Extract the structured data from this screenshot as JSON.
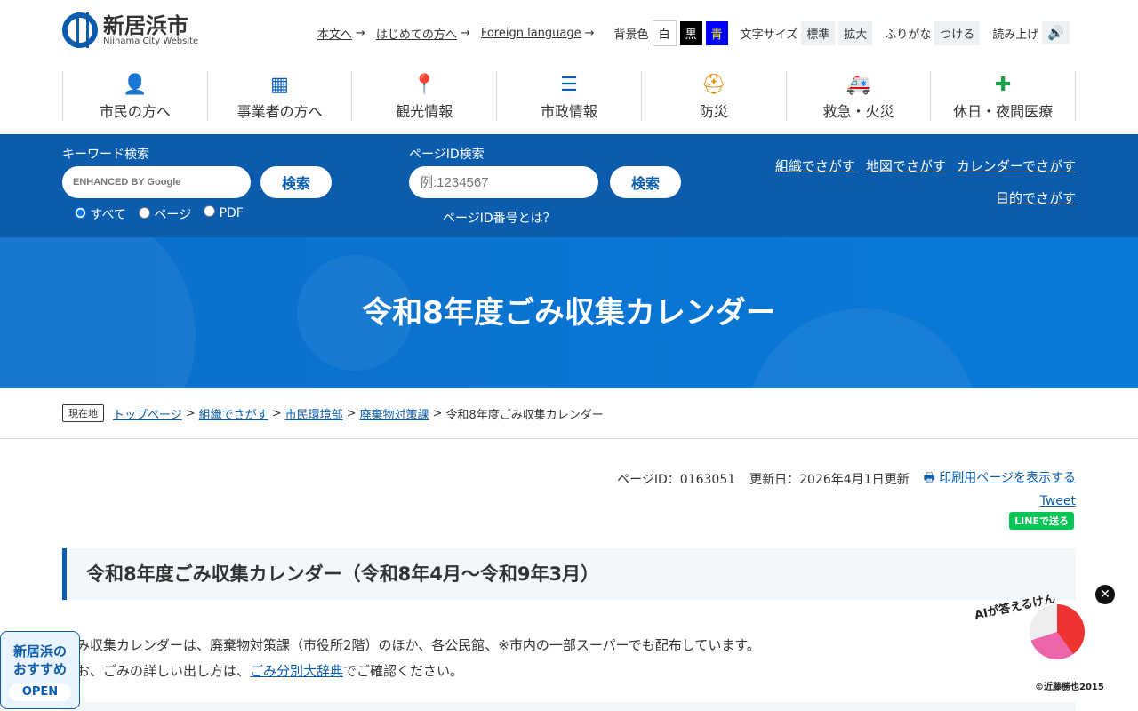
{
  "header": {
    "logo_title": "新居浜市",
    "logo_sub": "Niihama City Website",
    "links": [
      "本文へ",
      "はじめての方へ",
      "Foreign language"
    ],
    "bg_label": "背景色",
    "bg_options": [
      "白",
      "黒",
      "青"
    ],
    "size_label": "文字サイズ",
    "size_options": [
      "標準",
      "拡大"
    ],
    "furigana_label": "ふりがな",
    "furigana_button": "つける",
    "read_label": "読み上げ"
  },
  "nav": [
    {
      "label": "市民の方へ",
      "icon": "person-icon",
      "glyph": "👤",
      "color": "#0b5cad"
    },
    {
      "label": "事業者の方へ",
      "icon": "building-icon",
      "glyph": "▦",
      "color": "#0b5cad"
    },
    {
      "label": "観光情報",
      "icon": "map-pin-icon",
      "glyph": "📍",
      "color": "#0b5cad"
    },
    {
      "label": "市政情報",
      "icon": "list-icon",
      "glyph": "☰",
      "color": "#0b5cad"
    },
    {
      "label": "防災",
      "icon": "helmet-icon",
      "glyph": "⛑",
      "color": "#e08a00"
    },
    {
      "label": "救急・火災",
      "icon": "ambulance-icon",
      "glyph": "🚑",
      "color": "#d0202a"
    },
    {
      "label": "休日・夜間医療",
      "icon": "medical-kit-icon",
      "glyph": "✚",
      "color": "#1aa34a"
    }
  ],
  "search": {
    "keyword_label": "キーワード検索",
    "keyword_placeholder": "ENHANCED BY Google",
    "search_button": "検索",
    "radios": [
      "すべて",
      "ページ",
      "PDF"
    ],
    "pageid_label": "ページID検索",
    "pageid_placeholder": "例:1234567",
    "pageid_button": "検索",
    "pageid_help": "ページID番号とは？",
    "links": [
      "組織でさがす",
      "地図でさがす",
      "カレンダーでさがす",
      "目的でさがす"
    ]
  },
  "hero": {
    "title": "令和8年度ごみ収集カレンダー"
  },
  "breadcrumb": {
    "tag": "現在地",
    "items": [
      "トップページ",
      "組織でさがす",
      "市民環境部",
      "廃棄物対策課"
    ],
    "current": "令和8年度ごみ収集カレンダー"
  },
  "meta": {
    "page_id": "ページID：0163051",
    "updated": "更新日：2026年4月1日更新",
    "print": "印刷用ページを表示する",
    "tweet": "Tweet",
    "line": "LINEで送る"
  },
  "content": {
    "heading": "令和8年度ごみ収集カレンダー（令和8年4月～令和9年3月）",
    "p1": "み収集カレンダーは、廃棄物対策課（市役所2階）のほか、各公民館、※市内の一部スーパーでも配布しています。",
    "p2_pre": "お、ごみの詳しい出し方は、",
    "p2_link": "ごみ分別大辞典",
    "p2_post": "でご確認ください。"
  },
  "recommend": {
    "line1": "新居浜の",
    "line2": "おすすめ",
    "open": "OPEN"
  },
  "ai": {
    "label": "AIが答えるけん",
    "copyright": "©近藤勝也2015"
  }
}
